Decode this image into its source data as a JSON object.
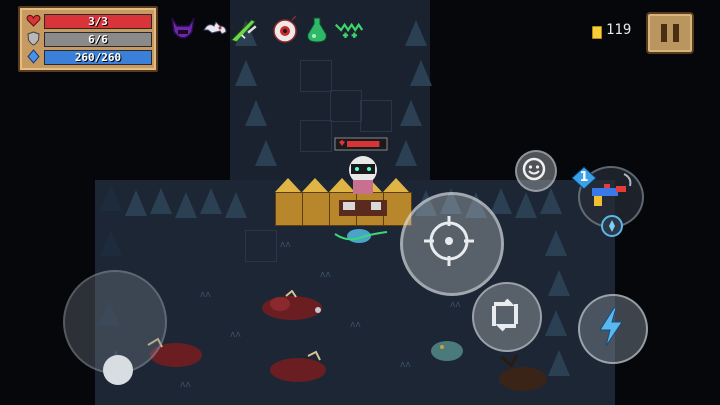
{
  "hud": {
    "health": {
      "text": "3/3",
      "fill": 1.0,
      "color": "#d8343a",
      "icon": "heart-icon"
    },
    "armor": {
      "text": "6/6",
      "fill": 1.0,
      "color": "#8a8a8a",
      "icon": "shield-icon"
    },
    "energy": {
      "text": "260/260",
      "fill": 1.0,
      "color": "#3a7fd8",
      "icon": "energy-crystal-icon"
    }
  },
  "buffs": [
    {
      "icon": "purple-horned-helmet-icon"
    },
    {
      "icon": "skeleton-beast-icon"
    },
    {
      "icon": "green-sword-icon"
    },
    {
      "icon": "eyeball-icon"
    },
    {
      "icon": "green-potion-icon"
    },
    {
      "icon": "green-wings-icon"
    }
  ],
  "coins": {
    "value": "119",
    "icon": "gold-coin-icon"
  },
  "pause": {
    "icon": "pause-icon"
  },
  "weapon": {
    "badge": "1",
    "icon": "toy-blaster-icon",
    "energy_icon": "energy-crystal-icon"
  },
  "controls": {
    "joystick": "movement-joystick",
    "attack": "crosshair-icon",
    "swap": "swap-weapon-icon",
    "skill": "lightning-bolt-icon",
    "emote": "smiley-icon"
  },
  "player": {
    "health_fill": 0.9,
    "health_color": "#d8343a"
  },
  "colors": {
    "floor": "#1c2634",
    "hud_frame": "#c79a62",
    "crate": "#b8862b"
  }
}
